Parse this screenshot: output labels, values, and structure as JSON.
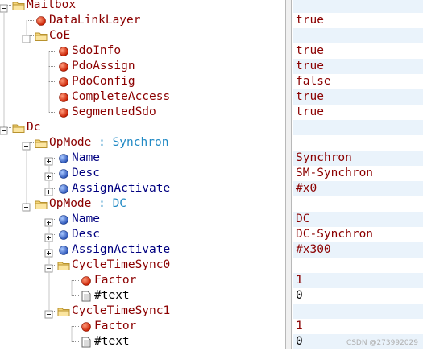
{
  "nodes": [
    {
      "label": "Mailbox",
      "depth": 0,
      "kind": "folder",
      "toggle": "minus",
      "value": ""
    },
    {
      "label": "DataLinkLayer",
      "depth": 1,
      "kind": "red",
      "toggle": "",
      "value": "true"
    },
    {
      "label": "CoE",
      "depth": 1,
      "kind": "folder",
      "toggle": "minus",
      "value": ""
    },
    {
      "label": "SdoInfo",
      "depth": 2,
      "kind": "red",
      "toggle": "",
      "value": "true"
    },
    {
      "label": "PdoAssign",
      "depth": 2,
      "kind": "red",
      "toggle": "",
      "value": "true"
    },
    {
      "label": "PdoConfig",
      "depth": 2,
      "kind": "red",
      "toggle": "",
      "value": "false"
    },
    {
      "label": "CompleteAccess",
      "depth": 2,
      "kind": "red",
      "toggle": "",
      "value": "true"
    },
    {
      "label": "SegmentedSdo",
      "depth": 2,
      "kind": "red",
      "toggle": "",
      "value": "true"
    },
    {
      "label": "Dc",
      "depth": 0,
      "kind": "folder",
      "toggle": "minus",
      "value": ""
    },
    {
      "label": "OpMode",
      "annotation": " : Synchron",
      "depth": 1,
      "kind": "folder",
      "toggle": "minus",
      "value": ""
    },
    {
      "label": "Name",
      "depth": 2,
      "kind": "blue",
      "toggle": "plus",
      "value": "Synchron"
    },
    {
      "label": "Desc",
      "depth": 2,
      "kind": "blue",
      "toggle": "plus",
      "value": "SM-Synchron"
    },
    {
      "label": "AssignActivate",
      "depth": 2,
      "kind": "blue",
      "toggle": "plus",
      "value": "#x0"
    },
    {
      "label": "OpMode",
      "annotation": " : DC",
      "depth": 1,
      "kind": "folder",
      "toggle": "minus",
      "value": ""
    },
    {
      "label": "Name",
      "depth": 2,
      "kind": "blue",
      "toggle": "plus",
      "value": "DC"
    },
    {
      "label": "Desc",
      "depth": 2,
      "kind": "blue",
      "toggle": "plus",
      "value": "DC-Synchron"
    },
    {
      "label": "AssignActivate",
      "depth": 2,
      "kind": "blue",
      "toggle": "plus",
      "value": "#x300"
    },
    {
      "label": "CycleTimeSync0",
      "depth": 2,
      "kind": "folder",
      "toggle": "minus",
      "value": ""
    },
    {
      "label": "Factor",
      "depth": 3,
      "kind": "red",
      "toggle": "",
      "value": "1"
    },
    {
      "label": "#text",
      "depth": 3,
      "kind": "text",
      "toggle": "",
      "value": "0"
    },
    {
      "label": "CycleTimeSync1",
      "depth": 2,
      "kind": "folder",
      "toggle": "minus",
      "value": ""
    },
    {
      "label": "Factor",
      "depth": 3,
      "kind": "red",
      "toggle": "",
      "value": "1"
    },
    {
      "label": "#text",
      "depth": 3,
      "kind": "text",
      "toggle": "",
      "value": "0"
    }
  ],
  "watermark": "CSDN @273992029",
  "colors": {
    "element_label": "#8b0000",
    "attribute_label": "#000080",
    "annotation": "#2089c4",
    "value": "#8b0000",
    "stripe": "#eaf3fb"
  },
  "icons": {
    "folder": "folder-icon",
    "red": "element-bullet-icon",
    "blue": "attribute-bullet-icon",
    "text": "text-node-icon",
    "minus": "collapse-toggle-icon",
    "plus": "expand-toggle-icon"
  }
}
